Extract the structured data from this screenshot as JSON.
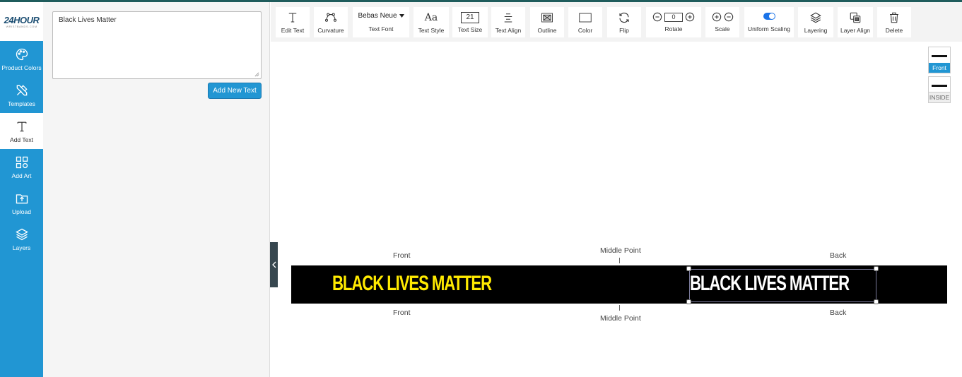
{
  "logo": {
    "brand": "24HOUR",
    "tagline": "WRISTBANDS.COM"
  },
  "nav": {
    "items": [
      {
        "label": "Product Colors",
        "icon": "palette-icon"
      },
      {
        "label": "Templates",
        "icon": "tools-icon"
      },
      {
        "label": "Add Text",
        "icon": "text-icon"
      },
      {
        "label": "Add Art",
        "icon": "art-icon"
      },
      {
        "label": "Upload",
        "icon": "upload-folder-icon"
      },
      {
        "label": "Layers",
        "icon": "layers-icon"
      }
    ],
    "active": "Add Text"
  },
  "panel": {
    "text_value": "Black Lives Matter",
    "add_button": "Add New Text"
  },
  "toolbar": {
    "edit_text": "Edit Text",
    "curvature": "Curvature",
    "font_value": "Bebas Neue",
    "text_font": "Text Font",
    "text_style": "Text Style",
    "text_style_glyph": "Aa",
    "size_value": "21",
    "text_size": "Text Size",
    "text_align": "Text Align",
    "outline": "Outline",
    "color": "Color",
    "flip": "Flip",
    "rotate_value": "0",
    "rotate": "Rotate",
    "scale": "Scale",
    "uniform_scaling": "Uniform Scaling",
    "uniform_scaling_on": true,
    "layering": "Layering",
    "layer_align": "Layer Align",
    "delete": "Delete"
  },
  "views": {
    "front": "Front",
    "inside": "INSIDE",
    "selected": "Front"
  },
  "canvas": {
    "top_front": "Front",
    "top_middle": "Middle Point",
    "top_back": "Back",
    "bottom_front": "Front",
    "bottom_middle": "Middle Point",
    "bottom_back": "Back",
    "strap_color": "#000000",
    "front_text": "BLACK LIVES MATTER",
    "front_text_color": "#ffea00",
    "back_text": "BLACK LIVES MATTER",
    "back_text_color": "#ffffff"
  },
  "colors": {
    "accent": "#2196d3",
    "header_line": "#1f5c5c"
  }
}
